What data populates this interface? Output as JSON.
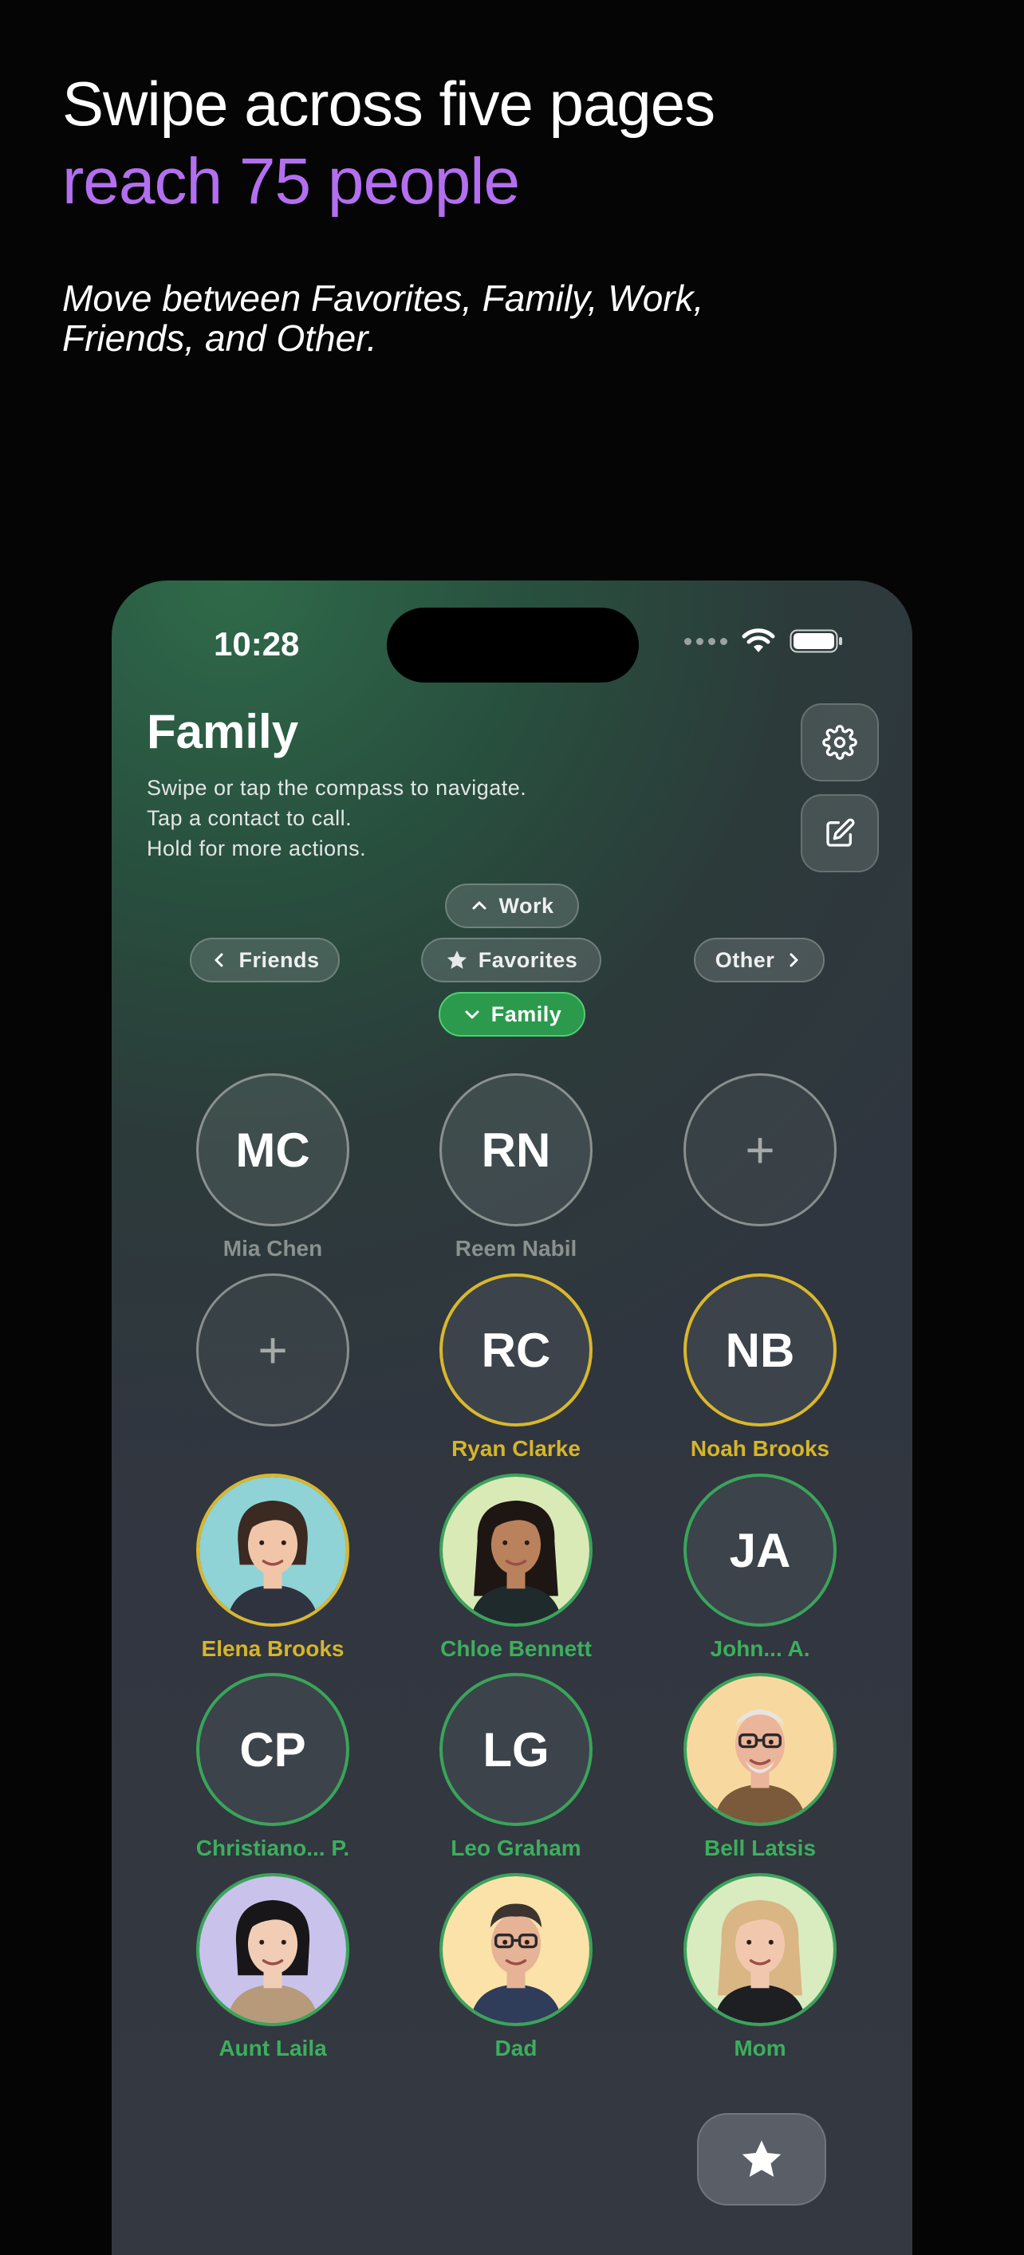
{
  "promo": {
    "headline": "Swipe across five pages",
    "headline_accent": "reach 75 people",
    "subline": "Move between Favorites, Family, Work, Friends, and Other."
  },
  "status_bar": {
    "time": "10:28"
  },
  "page": {
    "title": "Family",
    "help_lines": [
      "Swipe or tap the compass to navigate.",
      "Tap a contact to call.",
      "Hold for more actions."
    ]
  },
  "compass": {
    "up": "Work",
    "left": "Friends",
    "center": "Favorites",
    "right": "Other",
    "down": "Family"
  },
  "contacts": [
    {
      "initials": "MC",
      "name": "Mia Chen",
      "style": "grey"
    },
    {
      "initials": "RN",
      "name": "Reem Nabil",
      "style": "grey"
    },
    {
      "initials": "+",
      "name": "",
      "style": "add"
    },
    {
      "initials": "+",
      "name": "",
      "style": "add"
    },
    {
      "initials": "RC",
      "name": "Ryan Clarke",
      "style": "yellow"
    },
    {
      "initials": "NB",
      "name": "Noah Brooks",
      "style": "yellow"
    },
    {
      "initials": "",
      "name": "Elena Brooks",
      "style": "yellow",
      "avatar": "woman-short-hair"
    },
    {
      "initials": "",
      "name": "Chloe Bennett",
      "style": "green",
      "avatar": "woman-long-hair"
    },
    {
      "initials": "JA",
      "name": "John... A.",
      "style": "green"
    },
    {
      "initials": "CP",
      "name": "Christiano... P.",
      "style": "green"
    },
    {
      "initials": "LG",
      "name": "Leo Graham",
      "style": "green"
    },
    {
      "initials": "",
      "name": "Bell Latsis",
      "style": "green",
      "avatar": "older-man"
    },
    {
      "initials": "",
      "name": "Aunt Laila",
      "style": "green",
      "avatar": "woman-bob"
    },
    {
      "initials": "",
      "name": "Dad",
      "style": "green",
      "avatar": "man-glasses"
    },
    {
      "initials": "",
      "name": "Mom",
      "style": "green",
      "avatar": "woman-blonde"
    }
  ],
  "colors": {
    "accent_purple": "#b36ff0",
    "active_green": "#2c9a4d",
    "ring_yellow": "#d9b72d",
    "ring_green": "#3aa45a"
  }
}
